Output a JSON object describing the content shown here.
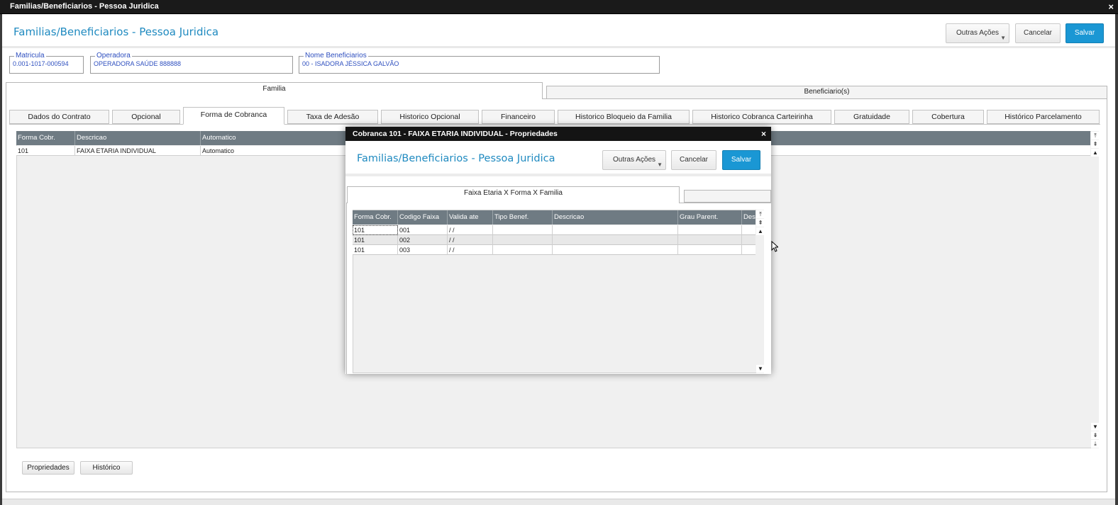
{
  "window": {
    "title": "Familias/Beneficiarios - Pessoa Juridica",
    "close_glyph": "×"
  },
  "header": {
    "title": "Familias/Beneficiarios - Pessoa Juridica",
    "btn_other": "Outras Ações",
    "btn_cancel": "Cancelar",
    "btn_save": "Salvar"
  },
  "fields": {
    "matricula": {
      "label": "Matricula",
      "value": "0.001-1017-000594"
    },
    "operadora": {
      "label": "Operadora",
      "value": "OPERADORA SAÚDE 888888"
    },
    "nome": {
      "label": "Nome Beneficiarios",
      "value": "00 - ISADORA JÉSSICA GALVÃO"
    }
  },
  "outer_tabs": [
    "Familia",
    "Beneficiario(s)"
  ],
  "inner_tabs": [
    "Dados do Contrato",
    "Opcional",
    "Forma de Cobranca",
    "Taxa de Adesão",
    "Historico Opcional",
    "Financeiro",
    "Historico Bloqueio da Familia",
    "Historico Cobranca Carteirinha",
    "Gratuidade",
    "Cobertura",
    "Histórico Parcelamento"
  ],
  "main_grid": {
    "headers": [
      "Forma Cobr.",
      "Descricao",
      "Automatico"
    ],
    "row": [
      "101",
      "FAIXA ETARIA INDIVIDUAL",
      "Automatico"
    ]
  },
  "bottom_buttons": {
    "propriedades": "Propriedades",
    "historico": "Histórico"
  },
  "modal": {
    "title": "Cobranca 101 - FAIXA ETARIA INDIVIDUAL - Propriedades",
    "close_glyph": "×",
    "header_title": "Familias/Beneficiarios - Pessoa Juridica",
    "btn_other": "Outras Ações",
    "btn_cancel": "Cancelar",
    "btn_save": "Salvar",
    "tab": "Faixa Etaria X Forma X Familia",
    "grid_headers": [
      "Forma Cobr.",
      "Codigo Faixa",
      "Valida ate",
      "Tipo Benef.",
      "Descricao",
      "Grau Parent.",
      "Des"
    ],
    "rows": [
      [
        "101",
        "001",
        "/ /",
        "",
        "",
        "",
        ""
      ],
      [
        "101",
        "002",
        "/ /",
        "",
        "",
        "",
        ""
      ],
      [
        "101",
        "003",
        "/ /",
        "",
        "",
        "",
        ""
      ]
    ]
  },
  "colors": {
    "accent": "#1a97d4",
    "title_blue": "#1f8ac0",
    "grid_header": "#6f7b83",
    "label_blue": "#2e4fbf"
  }
}
